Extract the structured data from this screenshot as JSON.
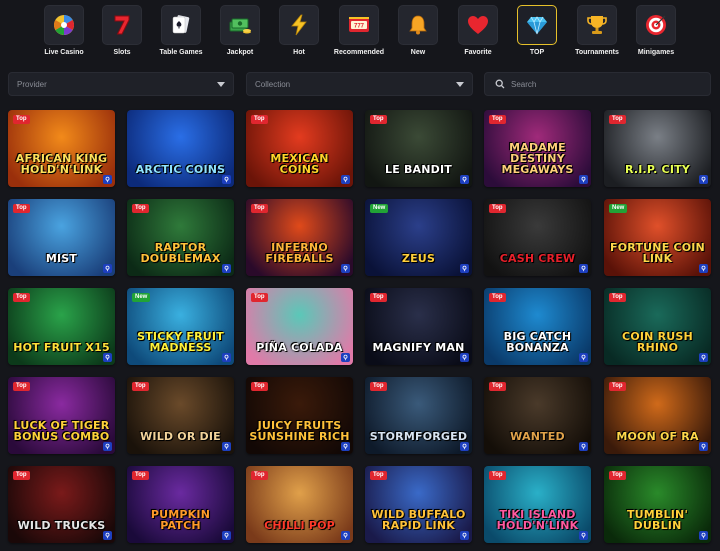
{
  "categories": [
    {
      "label": "Live Casino",
      "icon": "roulette-wheel-icon",
      "active": false
    },
    {
      "label": "Slots",
      "icon": "lucky-seven-icon",
      "active": false
    },
    {
      "label": "Table Games",
      "icon": "playing-cards-icon",
      "active": false
    },
    {
      "label": "Jackpot",
      "icon": "money-stack-icon",
      "active": false
    },
    {
      "label": "Hot",
      "icon": "lightning-icon",
      "active": false
    },
    {
      "label": "Recommended",
      "icon": "slot-machine-icon",
      "active": false
    },
    {
      "label": "New",
      "icon": "bell-icon",
      "active": false
    },
    {
      "label": "Favorite",
      "icon": "heart-icon",
      "active": false
    },
    {
      "label": "TOP",
      "icon": "diamond-icon",
      "active": true
    },
    {
      "label": "Tournaments",
      "icon": "trophy-icon",
      "active": false
    },
    {
      "label": "Minigames",
      "icon": "target-icon",
      "active": false
    }
  ],
  "filters": {
    "provider_placeholder": "Provider",
    "collection_placeholder": "Collection",
    "search_placeholder": "Search"
  },
  "colors": {
    "accent": "#e6c02a",
    "badge_top": "#e0262f",
    "badge_new": "#21a336"
  },
  "games": [
    {
      "title": "AFRICAN KING HOLD'N'LINK",
      "badge": "Top",
      "bg": [
        "#f28a1a",
        "#9a2f0b"
      ],
      "text": "#ffe15a"
    },
    {
      "title": "ARCTIC COINS",
      "badge": "",
      "bg": [
        "#2a6ee6",
        "#0c2a7a"
      ],
      "text": "#8fe3ff"
    },
    {
      "title": "MEXICAN COINS",
      "badge": "Top",
      "bg": [
        "#e33b1f",
        "#6b1408"
      ],
      "text": "#ffd52a"
    },
    {
      "title": "LE BANDIT",
      "badge": "Top",
      "bg": [
        "#3b4a36",
        "#121612"
      ],
      "text": "#ffffff"
    },
    {
      "title": "MADAME DESTINY MEGAWAYS",
      "badge": "Top",
      "bg": [
        "#a02a7a",
        "#2c0c3a"
      ],
      "text": "#ffd07a"
    },
    {
      "title": "R.I.P. CITY",
      "badge": "Top",
      "bg": [
        "#7a7f86",
        "#1c1e22"
      ],
      "text": "#e8ff52"
    },
    {
      "title": "MIST",
      "badge": "Top",
      "bg": [
        "#4aa3e0",
        "#1a3f7a"
      ],
      "text": "#ffffff"
    },
    {
      "title": "RAPTOR DOUBLEMAX",
      "badge": "Top",
      "bg": [
        "#2f7a3a",
        "#0c2a16"
      ],
      "text": "#ffc23a"
    },
    {
      "title": "INFERNO FIREBALLS",
      "badge": "Top",
      "bg": [
        "#e04a1a",
        "#2a0a2a"
      ],
      "text": "#ffb63a"
    },
    {
      "title": "ZEUS",
      "badge": "New",
      "bg": [
        "#2b3f8a",
        "#0a1238"
      ],
      "text": "#ffcf3a"
    },
    {
      "title": "CASH CREW",
      "badge": "Top",
      "bg": [
        "#3a3a3a",
        "#121212"
      ],
      "text": "#e8202a"
    },
    {
      "title": "FORTUNE COIN LINK",
      "badge": "New",
      "bg": [
        "#e0502a",
        "#5a1208"
      ],
      "text": "#ffd84a"
    },
    {
      "title": "HOT FRUIT X15",
      "badge": "Top",
      "bg": [
        "#2aa34a",
        "#0c3a1a"
      ],
      "text": "#ffe03a"
    },
    {
      "title": "STICKY FRUIT MADNESS",
      "badge": "New",
      "bg": [
        "#3ab0e0",
        "#0e4a7a"
      ],
      "text": "#fff23a"
    },
    {
      "title": "PIÑA COLADA",
      "badge": "Top",
      "bg": [
        "#5ac8b8",
        "#e07aa8"
      ],
      "text": "#ffffff"
    },
    {
      "title": "MAGNIFY MAN",
      "badge": "Top",
      "bg": [
        "#2a2f4a",
        "#0a0c18"
      ],
      "text": "#ffffff"
    },
    {
      "title": "BIG CATCH BONANZA",
      "badge": "Top",
      "bg": [
        "#1e8ad0",
        "#0a3a6a"
      ],
      "text": "#ffffff"
    },
    {
      "title": "COIN RUSH RHINO",
      "badge": "Top",
      "bg": [
        "#1a6a5a",
        "#082a24"
      ],
      "text": "#ffd23a"
    },
    {
      "title": "LUCK OF TIGER BONUS COMBO",
      "badge": "Top",
      "bg": [
        "#8a2aa0",
        "#2a0a3a"
      ],
      "text": "#ffd23a"
    },
    {
      "title": "WILD OR DIE",
      "badge": "Top",
      "bg": [
        "#6a4a2a",
        "#1a120a"
      ],
      "text": "#f2d39a"
    },
    {
      "title": "JUICY FRUITS SUNSHINE RICH",
      "badge": "Top",
      "bg": [
        "#3a1a0a",
        "#120805"
      ],
      "text": "#ffc23a"
    },
    {
      "title": "STORMFORGED",
      "badge": "Top",
      "bg": [
        "#3a5a7a",
        "#0e1a2a"
      ],
      "text": "#d8e4f2"
    },
    {
      "title": "WANTED",
      "badge": "Top",
      "bg": [
        "#4a3a2a",
        "#140e08"
      ],
      "text": "#e0a24a"
    },
    {
      "title": "MOON OF RA",
      "badge": "Top",
      "bg": [
        "#d06a1a",
        "#3a1a0a"
      ],
      "text": "#ffd84a"
    },
    {
      "title": "WILD TRUCKS",
      "badge": "Top",
      "bg": [
        "#7a1a1a",
        "#1a0808"
      ],
      "text": "#e6e6e6"
    },
    {
      "title": "PUMPKIN PATCH",
      "badge": "Top",
      "bg": [
        "#6a2aa0",
        "#1a0a3a"
      ],
      "text": "#ff9a2a"
    },
    {
      "title": "CHILLI POP",
      "badge": "Top",
      "bg": [
        "#e0a04a",
        "#7a3a1a"
      ],
      "text": "#ff3a2a"
    },
    {
      "title": "WILD BUFFALO RAPID LINK",
      "badge": "Top",
      "bg": [
        "#3a6ac8",
        "#1a1a4a"
      ],
      "text": "#ffc23a"
    },
    {
      "title": "TIKI ISLAND HOLD'N'LINK",
      "badge": "Top",
      "bg": [
        "#2ab0c8",
        "#0a4a6a"
      ],
      "text": "#ff5aa0"
    },
    {
      "title": "TUMBLIN' DUBLIN",
      "badge": "Top",
      "bg": [
        "#2a8a2a",
        "#0a2a0a"
      ],
      "text": "#ffd23a"
    }
  ]
}
